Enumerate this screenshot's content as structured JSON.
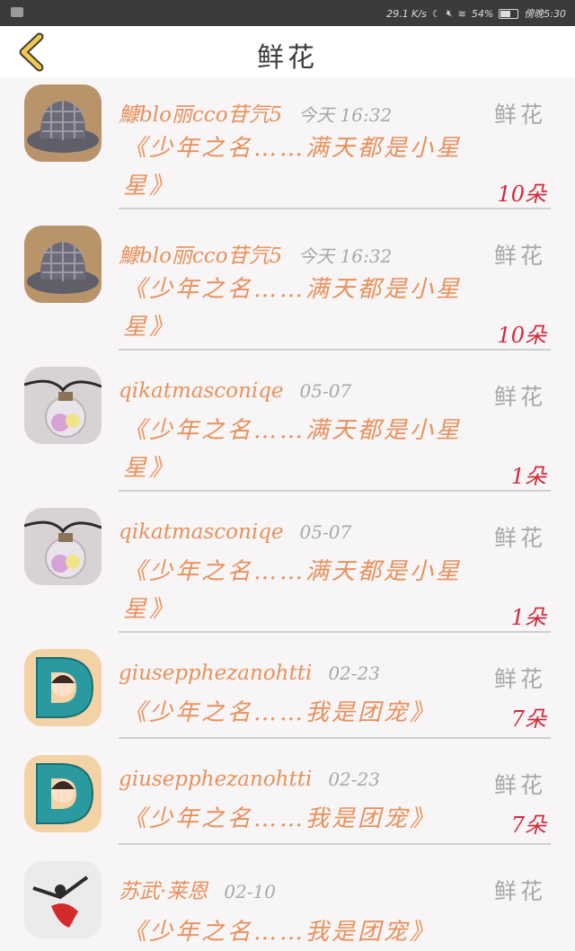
{
  "status_bar": {
    "speed": "29.1 K/s",
    "battery": "54%",
    "clock": "傍晚5:30"
  },
  "header": {
    "title": "鲜花"
  },
  "items": [
    {
      "name": "鱇blo丽cco苷氕5",
      "time": "今天 16:32",
      "type": "鲜花",
      "message": "《少年之名……满天都是小星星》",
      "count": "10朵",
      "avatar": "hat"
    },
    {
      "name": "鱇blo丽cco苷氕5",
      "time": "今天 16:32",
      "type": "鲜花",
      "message": "《少年之名……满天都是小星星》",
      "count": "10朵",
      "avatar": "hat"
    },
    {
      "name": "qikatmasconiqe",
      "time": "05-07",
      "type": "鲜花",
      "message": "《少年之名……满天都是小星星》",
      "count": "1朵",
      "avatar": "pendant"
    },
    {
      "name": "qikatmasconiqe",
      "time": "05-07",
      "type": "鲜花",
      "message": "《少年之名……满天都是小星星》",
      "count": "1朵",
      "avatar": "pendant"
    },
    {
      "name": "giusepphezanohtti",
      "time": "02-23",
      "type": "鲜花",
      "message": "《少年之名……我是团宠》",
      "count": "7朵",
      "avatar": "letter-d"
    },
    {
      "name": "giusepphezanohtti",
      "time": "02-23",
      "type": "鲜花",
      "message": "《少年之名……我是团宠》",
      "count": "7朵",
      "avatar": "letter-d"
    },
    {
      "name": "苏武·莱恩",
      "time": "02-10",
      "type": "鲜花",
      "message": "《少年之名……我是团宠》",
      "count": "",
      "avatar": "dancer"
    }
  ]
}
